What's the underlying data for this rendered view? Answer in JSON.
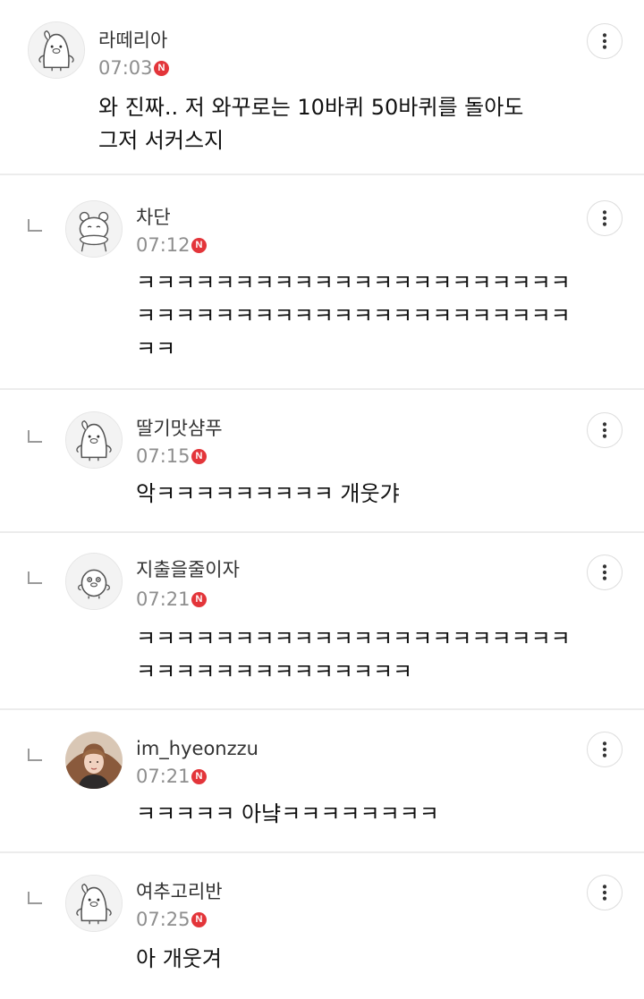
{
  "comments": [
    {
      "author": "라떼리아",
      "time": "07:03",
      "badge": "N",
      "text": "와 진짜.. 저 와꾸로는 10바퀴 50바퀴를 돌아도\n그저 서커스지",
      "avatar_icon": "penguin-character-icon",
      "more_icon": "more-vertical-icon"
    },
    {
      "author": "차단",
      "time": "07:12",
      "badge": "N",
      "text": "ㅋㅋㅋㅋㅋㅋㅋㅋㅋㅋㅋㅋㅋㅋㅋㅋㅋㅋㅋㅋㅋㅋ\nㅋㅋㅋㅋㅋㅋㅋㅋㅋㅋㅋㅋㅋㅋㅋㅋㅋㅋㅋㅋㅋㅋ\nㅋㅋ",
      "avatar_icon": "bear-character-icon",
      "more_icon": "more-vertical-icon"
    },
    {
      "author": "딸기맛샴푸",
      "time": "07:15",
      "badge": "N",
      "text": "악ㅋㅋㅋㅋㅋㅋㅋㅋㅋ 개웃갸",
      "avatar_icon": "penguin-character-icon",
      "more_icon": "more-vertical-icon"
    },
    {
      "author": "지출을줄이자",
      "time": "07:21",
      "badge": "N",
      "text": "ㅋㅋㅋㅋㅋㅋㅋㅋㅋㅋㅋㅋㅋㅋㅋㅋㅋㅋㅋㅋㅋㅋ\nㅋㅋㅋㅋㅋㅋㅋㅋㅋㅋㅋㅋㅋㅋ",
      "avatar_icon": "chick-character-icon",
      "more_icon": "more-vertical-icon"
    },
    {
      "author": "im_hyeonzzu",
      "time": "07:21",
      "badge": "N",
      "text": "ㅋㅋㅋㅋㅋ 아냨ㅋㅋㅋㅋㅋㅋㅋㅋ",
      "avatar_icon": "profile-photo",
      "more_icon": "more-vertical-icon"
    },
    {
      "author": "여추고리반",
      "time": "07:25",
      "badge": "N",
      "text": "아 개웃겨",
      "avatar_icon": "penguin-character-icon",
      "more_icon": "more-vertical-icon"
    }
  ],
  "colors": {
    "badge": "#e3353a",
    "divider": "#ececec",
    "time": "#8e8e8e",
    "author": "#333333",
    "body_text": "#111111"
  }
}
